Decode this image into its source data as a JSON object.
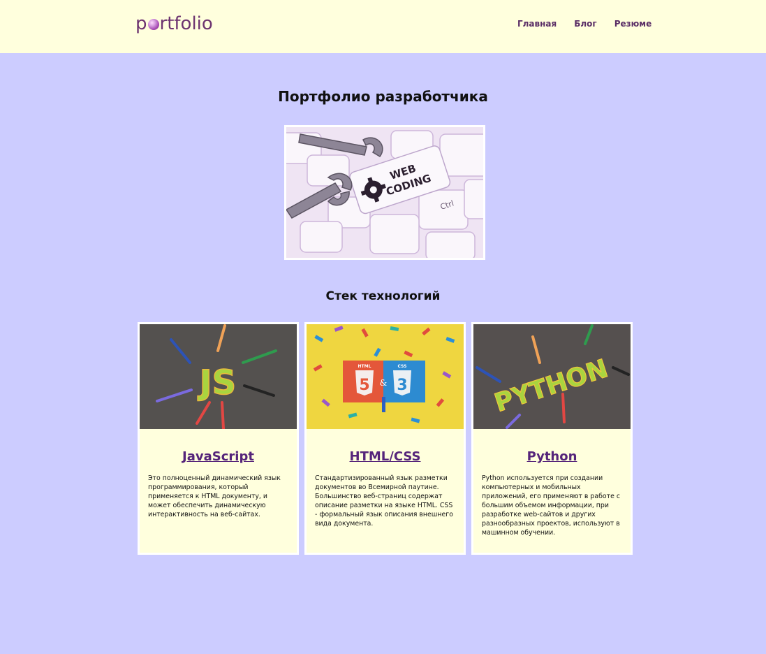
{
  "header": {
    "logo_pre": "p",
    "logo_post": "rtfolio",
    "nav": [
      {
        "label": "Главная"
      },
      {
        "label": "Блог"
      },
      {
        "label": "Резюме"
      }
    ]
  },
  "main": {
    "title": "Портфолио разработчика",
    "hero": {
      "line1": "WEB",
      "line2": "CODING",
      "ctrl": "Ctrl"
    },
    "stack_title": "Стек технологий"
  },
  "cards": [
    {
      "title": "JavaScript",
      "image_text": "JS",
      "description": "Это полноценный динамический язык программирования, который применяется к HTML документу, и может обеспечить динамическую интерактивность на веб-сайтах."
    },
    {
      "title": "HTML/CSS",
      "image_text": {
        "html": "HTML",
        "css": "CSS",
        "html_num": "5",
        "css_num": "3",
        "amp": "&"
      },
      "description": "Стандартизированный язык разметки документов во Всемирной паутине. Большинство веб-страниц содержат описание разметки на языке HTML. CSS - формальный язык описания внешнего вида документа."
    },
    {
      "title": "Python",
      "image_text": "PYTHON",
      "description": "Python используется при создании компьютерных и мобильных приложений, его применяют в работе с большим объемом информации, при разработке web-сайтов и других разнообразных проектов, используют в машинном обучении."
    }
  ],
  "colors": {
    "background": "#ccccff",
    "header_bg": "#ffffdd",
    "card_bg": "#ffffdd",
    "accent": "#55247a",
    "logo": "#6d3470"
  }
}
